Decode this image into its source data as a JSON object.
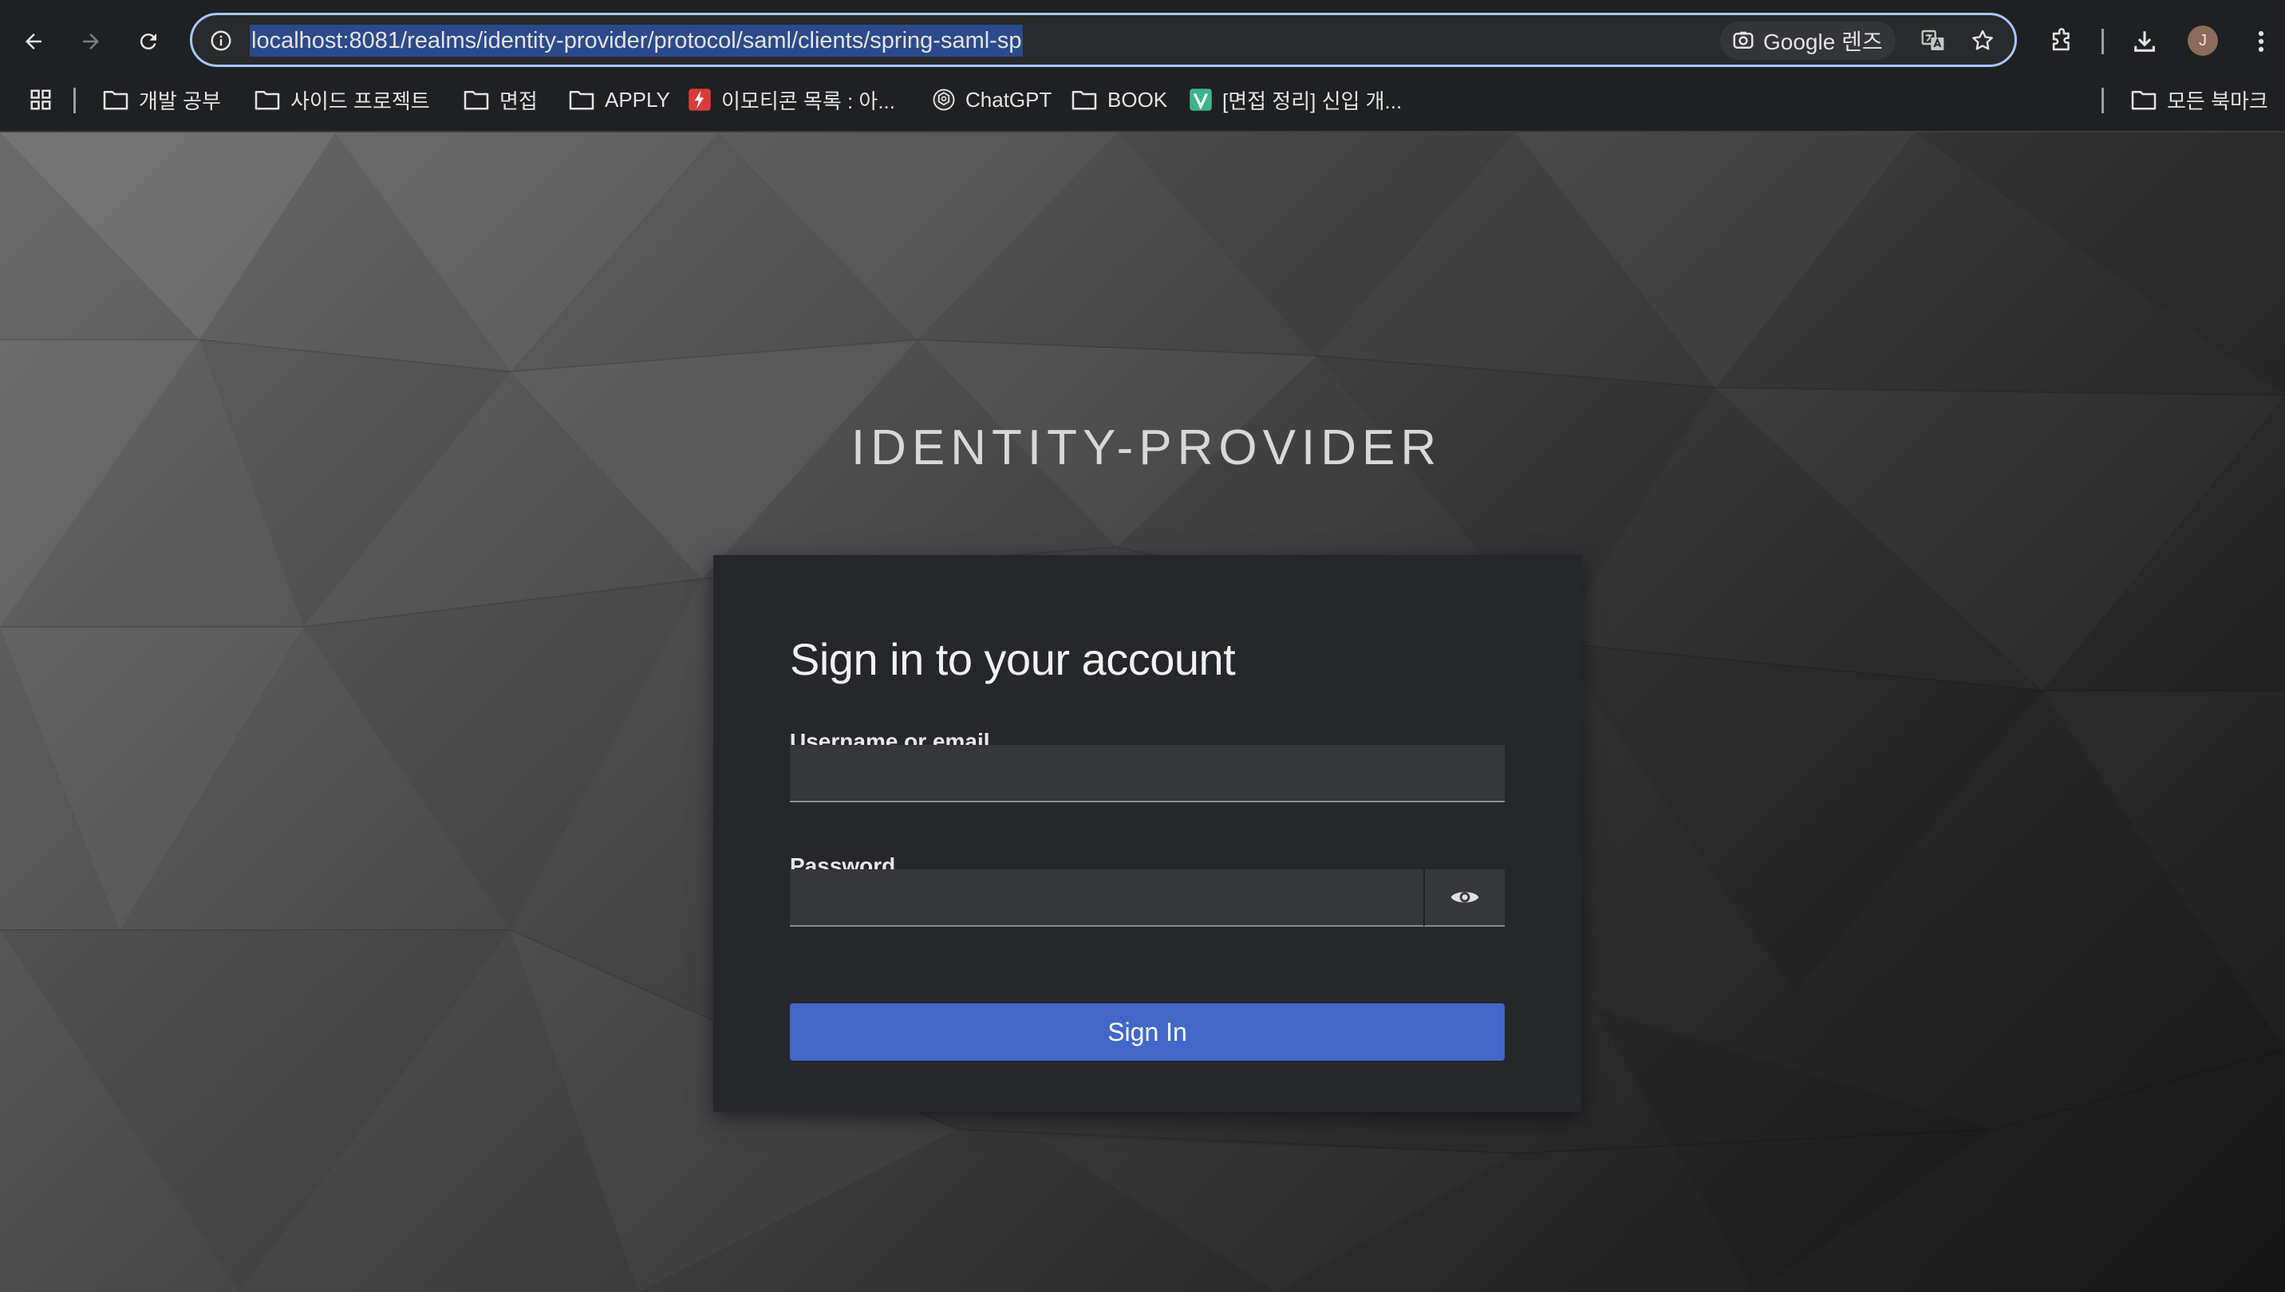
{
  "browser": {
    "url": "localhost:8081/realms/identity-provider/protocol/saml/clients/spring-saml-sp",
    "lens_label": "Google 렌즈",
    "avatar_initial": "J",
    "bookmarks": [
      {
        "label": "개발 공부",
        "icon": "folder-icon"
      },
      {
        "label": "사이드 프로젝트",
        "icon": "folder-icon"
      },
      {
        "label": "면접",
        "icon": "folder-icon"
      },
      {
        "label": "APPLY",
        "icon": "folder-icon"
      },
      {
        "label": "이모티콘 목록 : 아...",
        "icon": "lightning-site-icon"
      },
      {
        "label": "ChatGPT",
        "icon": "chatgpt-icon"
      },
      {
        "label": "BOOK",
        "icon": "folder-icon"
      },
      {
        "label": "[면접 정리] 신입 개...",
        "icon": "v-site-icon"
      }
    ],
    "all_bookmarks_label": "모든 북마크"
  },
  "login": {
    "realm_title": "IDENTITY-PROVIDER",
    "heading": "Sign in to your account",
    "username_label": "Username or email",
    "username_value": "",
    "password_label": "Password",
    "password_value": "",
    "signin_label": "Sign In"
  },
  "colors": {
    "accent": "#4267c9",
    "card_bg": "#26272b",
    "input_bg": "#36373b",
    "url_selection": "#2c4a8a",
    "omnibox_border": "#a8c7fa"
  }
}
